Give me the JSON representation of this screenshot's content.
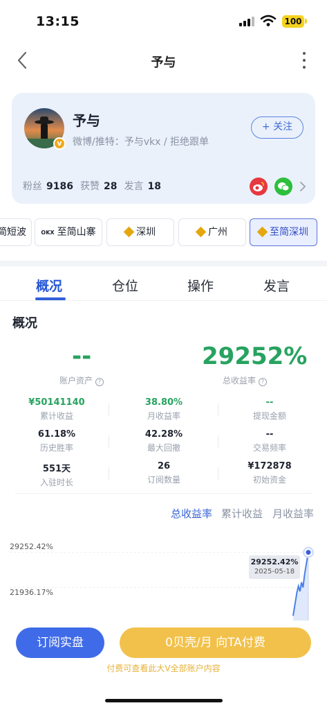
{
  "status_bar": {
    "time": "13:15",
    "battery": "100"
  },
  "nav": {
    "title": "予与"
  },
  "profile": {
    "name": "予与",
    "bio": "微博/推特：予与vkx / 拒绝跟单",
    "follow_label": "+ 关注",
    "verified_badge": "v",
    "stats": [
      {
        "label": "粉丝",
        "value": "9186"
      },
      {
        "label": "获赞",
        "value": "28"
      },
      {
        "label": "发言",
        "value": "18"
      }
    ],
    "social_icons": [
      "weibo-icon",
      "wechat-icon"
    ]
  },
  "chips": [
    {
      "label": "简短波",
      "icon": "",
      "active": false
    },
    {
      "label": "至简山寨",
      "icon": "okx-icon",
      "active": false
    },
    {
      "label": "深圳",
      "icon": "binance-icon",
      "active": false
    },
    {
      "label": "广州",
      "icon": "binance-icon",
      "active": false
    },
    {
      "label": "至简深圳",
      "icon": "binance-icon",
      "active": true
    }
  ],
  "okx_mark": "OKX",
  "tabs": [
    {
      "label": "概况",
      "active": true
    },
    {
      "label": "仓位",
      "active": false
    },
    {
      "label": "操作",
      "active": false
    },
    {
      "label": "发言",
      "active": false
    }
  ],
  "overview": {
    "title": "概况",
    "account_assets_value": "--",
    "account_assets_label": "账户资产",
    "total_return_value": "29252%",
    "total_return_label": "总收益率",
    "info_mark": "?",
    "metrics": [
      {
        "value": "¥50141140",
        "label": "累计收益",
        "color": "#27a35f"
      },
      {
        "value": "38.80%",
        "label": "月收益率",
        "color": "#27a35f"
      },
      {
        "value": "--",
        "label": "提现金额",
        "color": "#27a35f"
      },
      {
        "value": "61.18%",
        "label": "历史胜率",
        "color": "#1f2430"
      },
      {
        "value": "42.28%",
        "label": "最大回撤",
        "color": "#1f2430"
      },
      {
        "value": "--",
        "label": "交易频率",
        "color": "#1f2430"
      },
      {
        "value": "551天",
        "label": "入驻时长",
        "color": "#1f2430"
      },
      {
        "value": "26",
        "label": "订阅数量",
        "color": "#1f2430"
      },
      {
        "value": "¥172878",
        "label": "初始资金",
        "color": "#1f2430"
      }
    ]
  },
  "chart_tabs": [
    {
      "label": "总收益率",
      "active": true
    },
    {
      "label": "累计收益",
      "active": false
    },
    {
      "label": "月收益率",
      "active": false
    }
  ],
  "chart_data": {
    "type": "line",
    "y_tick_labels": [
      "29252.42%",
      "21936.17%"
    ],
    "yticks": [
      29252.42,
      21936.17
    ],
    "tooltip": {
      "value": "29252.42%",
      "date": "2025-05-18"
    },
    "points": [
      {
        "x": 0.0,
        "y": 16000
      },
      {
        "x": 0.25,
        "y": 20900
      },
      {
        "x": 0.35,
        "y": 22200
      },
      {
        "x": 0.45,
        "y": 21100
      },
      {
        "x": 0.55,
        "y": 23000
      },
      {
        "x": 0.65,
        "y": 21900
      },
      {
        "x": 0.75,
        "y": 24500
      },
      {
        "x": 0.85,
        "y": 26500
      },
      {
        "x": 1.0,
        "y": 29252.42
      }
    ],
    "ylim": [
      15000,
      30500
    ],
    "line_color": "#4a7fe6"
  },
  "cta": {
    "subscribe_label": "订阅实盘",
    "pay_label": "0贝壳/月 向TA付费",
    "note": "付费可查看此大V全部账户内容"
  }
}
